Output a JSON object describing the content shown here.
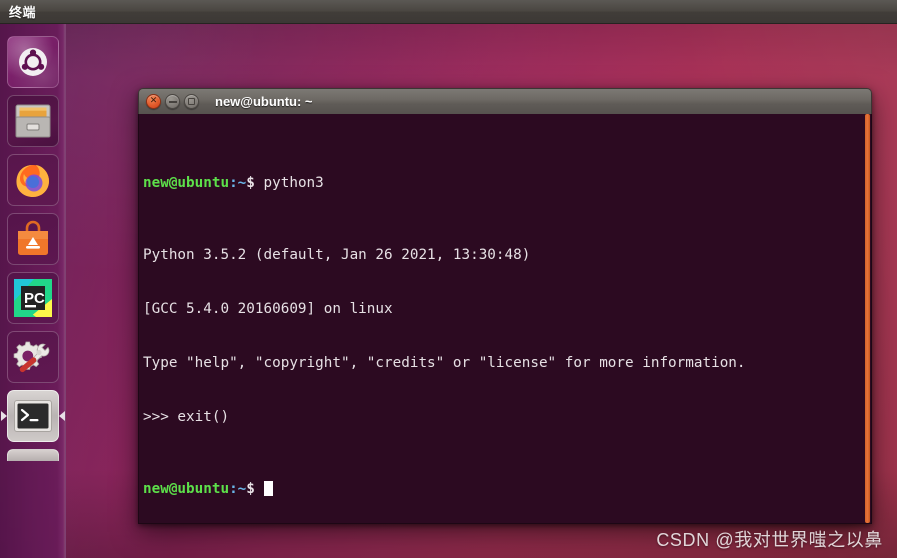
{
  "top_panel": {
    "title": "终端"
  },
  "launcher": {
    "items": [
      {
        "name": "dash-home",
        "label": "Ubuntu Dash Home",
        "icon": "ubuntu-logo-icon",
        "running": false
      },
      {
        "name": "files",
        "label": "Files",
        "icon": "file-cabinet-icon",
        "running": false
      },
      {
        "name": "firefox",
        "label": "Firefox Web Browser",
        "icon": "firefox-icon",
        "running": false
      },
      {
        "name": "ubuntu-software",
        "label": "Ubuntu Software",
        "icon": "software-bag-icon",
        "running": false
      },
      {
        "name": "pycharm",
        "label": "PyCharm",
        "icon": "pycharm-icon",
        "icon_text": "PC",
        "running": false
      },
      {
        "name": "system-settings",
        "label": "System Settings",
        "icon": "gear-wrench-icon",
        "running": false
      },
      {
        "name": "terminal",
        "label": "Terminal",
        "icon": "terminal-icon",
        "icon_text": ">_",
        "running": true
      }
    ]
  },
  "terminal_window": {
    "title": "new@ubuntu: ~",
    "buttons": {
      "close": "×",
      "minimize": "−",
      "maximize": "□"
    },
    "lines": [
      {
        "type": "prompt",
        "user": "new@ubuntu",
        "path": ":~",
        "dollar": "$",
        "command": " python3"
      },
      {
        "type": "output",
        "text": "Python 3.5.2 (default, Jan 26 2021, 13:30:48)"
      },
      {
        "type": "output",
        "text": "[GCC 5.4.0 20160609] on linux"
      },
      {
        "type": "output",
        "text": "Type \"help\", \"copyright\", \"credits\" or \"license\" for more information."
      },
      {
        "type": "output",
        "text": ">>> exit()"
      },
      {
        "type": "prompt-cursor",
        "user": "new@ubuntu",
        "path": ":~",
        "dollar": "$",
        "command": " "
      }
    ]
  },
  "watermark": {
    "text": "CSDN @我对世界嗤之以鼻"
  },
  "colors": {
    "panel_bg": "#45413d",
    "launcher_bg": "#60185 3",
    "terminal_bg": "#2c0a21",
    "prompt_green": "#5de04a",
    "prompt_blue": "#6ab6e8",
    "scrollbar_orange": "#e8743a",
    "close_button": "#e2592a"
  }
}
